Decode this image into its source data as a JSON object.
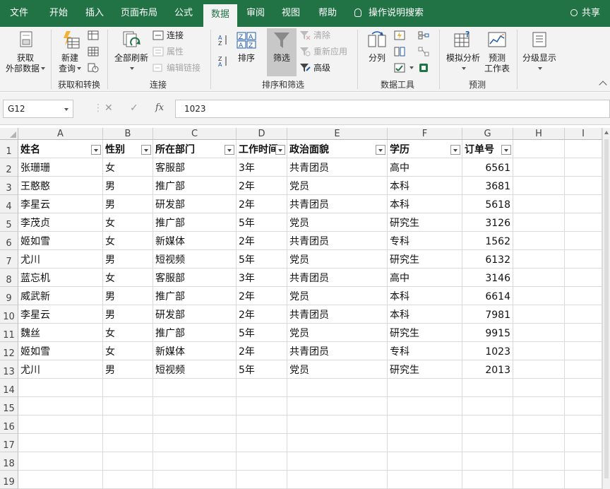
{
  "ribbon_tabs": [
    "文件",
    "开始",
    "插入",
    "页面布局",
    "公式",
    "数据",
    "审阅",
    "视图",
    "帮助"
  ],
  "active_tab": "数据",
  "tell_me": "操作说明搜索",
  "share": "共享",
  "groups": {
    "get_transform": {
      "label": "获取和转换",
      "get_data": [
        "获取",
        "外部数据"
      ],
      "new_query": [
        "新建",
        "查询"
      ]
    },
    "connections": {
      "label": "连接",
      "refresh_all": "全部刷新",
      "connections": "连接",
      "properties": "属性",
      "edit_links": "编辑链接"
    },
    "sort_filter": {
      "label": "排序和筛选",
      "sort": "排序",
      "filter": "筛选",
      "clear": "清除",
      "reapply": "重新应用",
      "advanced": "高级"
    },
    "data_tools": {
      "label": "数据工具",
      "text_to_columns": "分列"
    },
    "forecast": {
      "label": "预测",
      "what_if": "模拟分析",
      "forecast_sheet": [
        "预测",
        "工作表"
      ]
    },
    "outline": {
      "label": "分级显示"
    }
  },
  "name_box": "G12",
  "formula_value": "1023",
  "fx_label": "fx",
  "columns": [
    "A",
    "B",
    "C",
    "D",
    "E",
    "F",
    "G",
    "H",
    "I"
  ],
  "rows": [
    "1",
    "2",
    "3",
    "4",
    "5",
    "6",
    "7",
    "8",
    "9",
    "10",
    "11",
    "12",
    "13",
    "14",
    "15",
    "16",
    "17",
    "18",
    "19"
  ],
  "table": {
    "headers": [
      "姓名",
      "性别",
      "所在部门",
      "工作时间",
      "政治面貌",
      "学历",
      "订单号"
    ],
    "data": [
      [
        "张珊珊",
        "女",
        "客服部",
        "3年",
        "共青团员",
        "高中",
        "6561"
      ],
      [
        "王憨憨",
        "男",
        "推广部",
        "2年",
        "党员",
        "本科",
        "3681"
      ],
      [
        "李星云",
        "男",
        "研发部",
        "2年",
        "共青团员",
        "本科",
        "5618"
      ],
      [
        "李茂贞",
        "女",
        "推广部",
        "5年",
        "党员",
        "研究生",
        "3126"
      ],
      [
        "姬如雪",
        "女",
        "新媒体",
        "2年",
        "共青团员",
        "专科",
        "1562"
      ],
      [
        "尤川",
        "男",
        "短视频",
        "5年",
        "党员",
        "研究生",
        "6132"
      ],
      [
        "蓝忘机",
        "女",
        "客服部",
        "3年",
        "共青团员",
        "高中",
        "3146"
      ],
      [
        "威武新",
        "男",
        "推广部",
        "2年",
        "党员",
        "本科",
        "6614"
      ],
      [
        "李星云",
        "男",
        "研发部",
        "2年",
        "共青团员",
        "本科",
        "7981"
      ],
      [
        "魏丝",
        "女",
        "推广部",
        "5年",
        "党员",
        "研究生",
        "9915"
      ],
      [
        "姬如雪",
        "女",
        "新媒体",
        "2年",
        "共青团员",
        "专科",
        "1023"
      ],
      [
        "尤川",
        "男",
        "短视频",
        "5年",
        "党员",
        "研究生",
        "2013"
      ]
    ]
  },
  "colors": {
    "excel_green": "#217346",
    "ribbon_bg": "#f3f3f3",
    "grid_line": "#dadada",
    "header_bg": "#f1f1f1"
  }
}
